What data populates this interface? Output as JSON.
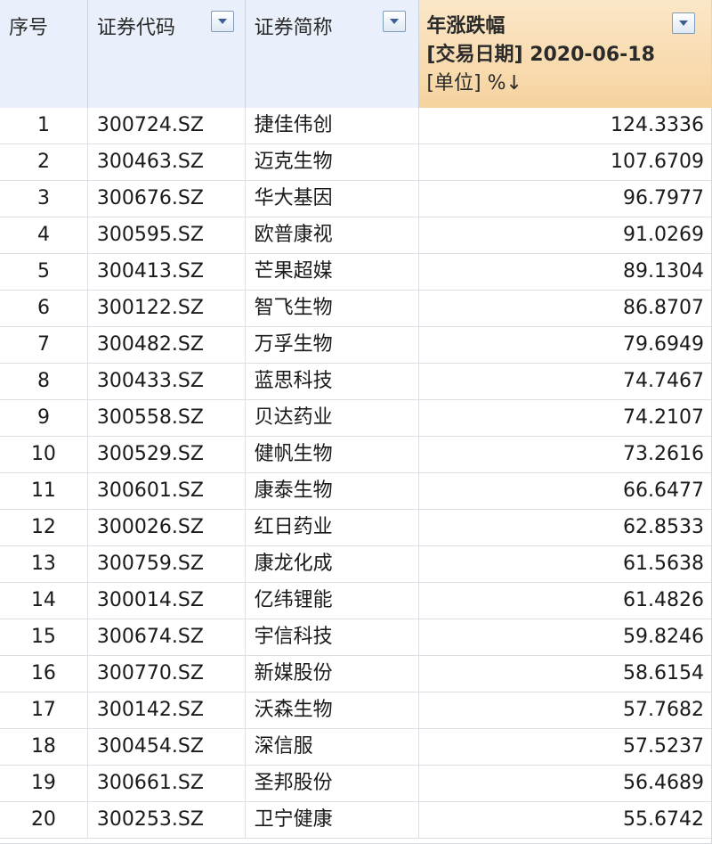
{
  "header": {
    "col_index": "序号",
    "col_code": "证券代码",
    "col_name": "证券简称",
    "col_change_title": "年涨跌幅",
    "col_change_date": "[交易日期] 2020-06-18",
    "col_change_unit": "[单位] %↓"
  },
  "rows": [
    {
      "index": "1",
      "code": "300724.SZ",
      "name": "捷佳伟创",
      "change": "124.3336"
    },
    {
      "index": "2",
      "code": "300463.SZ",
      "name": "迈克生物",
      "change": "107.6709"
    },
    {
      "index": "3",
      "code": "300676.SZ",
      "name": "华大基因",
      "change": "96.7977"
    },
    {
      "index": "4",
      "code": "300595.SZ",
      "name": "欧普康视",
      "change": "91.0269"
    },
    {
      "index": "5",
      "code": "300413.SZ",
      "name": "芒果超媒",
      "change": "89.1304"
    },
    {
      "index": "6",
      "code": "300122.SZ",
      "name": "智飞生物",
      "change": "86.8707"
    },
    {
      "index": "7",
      "code": "300482.SZ",
      "name": "万孚生物",
      "change": "79.6949"
    },
    {
      "index": "8",
      "code": "300433.SZ",
      "name": "蓝思科技",
      "change": "74.7467"
    },
    {
      "index": "9",
      "code": "300558.SZ",
      "name": "贝达药业",
      "change": "74.2107"
    },
    {
      "index": "10",
      "code": "300529.SZ",
      "name": "健帆生物",
      "change": "73.2616"
    },
    {
      "index": "11",
      "code": "300601.SZ",
      "name": "康泰生物",
      "change": "66.6477"
    },
    {
      "index": "12",
      "code": "300026.SZ",
      "name": "红日药业",
      "change": "62.8533"
    },
    {
      "index": "13",
      "code": "300759.SZ",
      "name": "康龙化成",
      "change": "61.5638"
    },
    {
      "index": "14",
      "code": "300014.SZ",
      "name": "亿纬锂能",
      "change": "61.4826"
    },
    {
      "index": "15",
      "code": "300674.SZ",
      "name": "宇信科技",
      "change": "59.8246"
    },
    {
      "index": "16",
      "code": "300770.SZ",
      "name": "新媒股份",
      "change": "58.6154"
    },
    {
      "index": "17",
      "code": "300142.SZ",
      "name": "沃森生物",
      "change": "57.7682"
    },
    {
      "index": "18",
      "code": "300454.SZ",
      "name": "深信服",
      "change": "57.5237"
    },
    {
      "index": "19",
      "code": "300661.SZ",
      "name": "圣邦股份",
      "change": "56.4689"
    },
    {
      "index": "20",
      "code": "300253.SZ",
      "name": "卫宁健康",
      "change": "55.6742"
    }
  ],
  "icons": {
    "filter": "filter-dropdown-icon"
  },
  "colors": {
    "header_bg": "#e9f0fb",
    "sorted_header_bg": "#f6d39f",
    "filter_arrow": "#3d5f94"
  }
}
